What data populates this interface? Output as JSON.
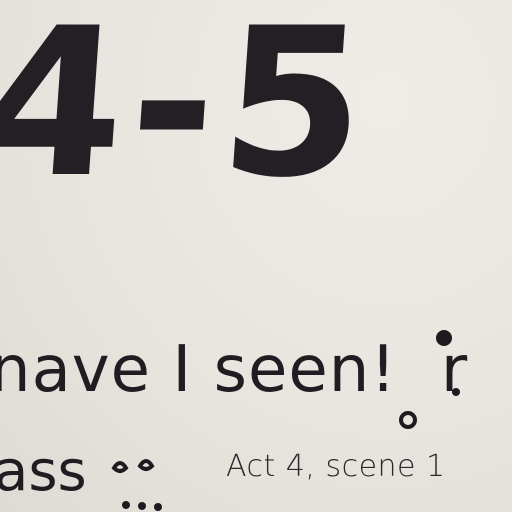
{
  "page": {
    "heading_number": "4-5",
    "quote_text": "nave I seen!",
    "quote_trailing": "r",
    "partial_word": "ass",
    "act_scene": "Act 4, scene 1"
  },
  "colors": {
    "paper": "#e9e6e0",
    "ink": "#1d1b1f"
  }
}
